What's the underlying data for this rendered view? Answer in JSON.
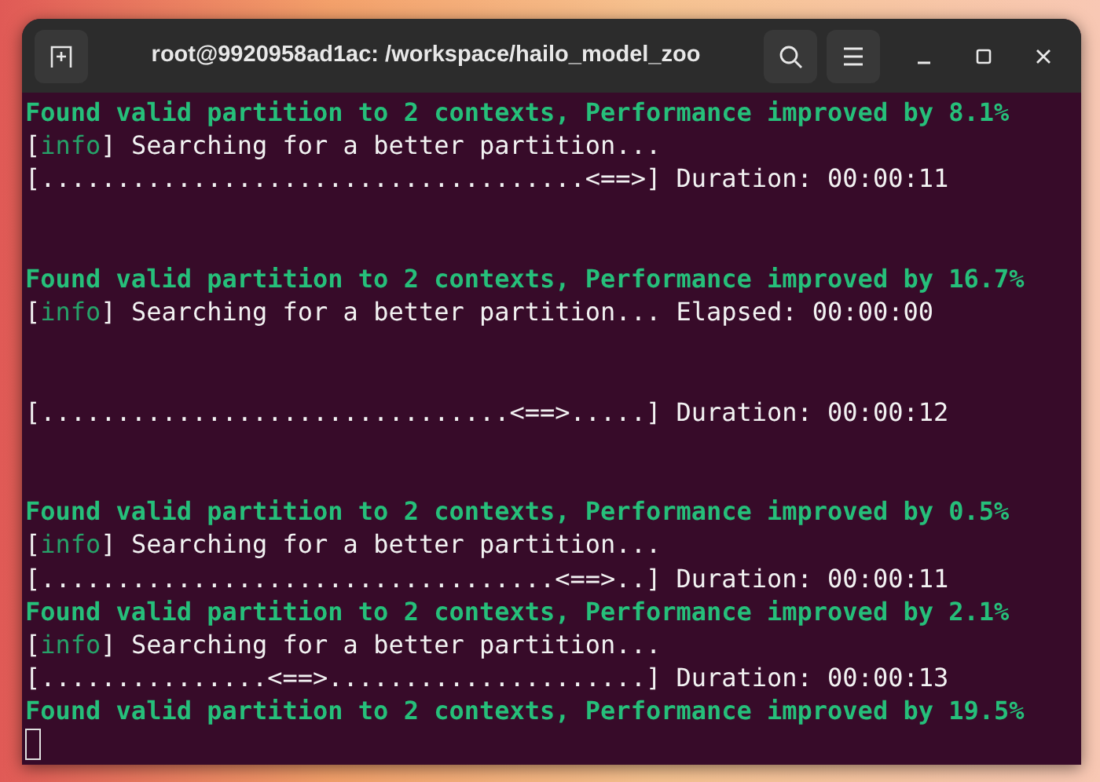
{
  "window": {
    "title": "root@9920958ad1ac: /workspace/hailo_model_zoo"
  },
  "lines": [
    {
      "kind": "found",
      "text": "Found valid partition to 2 contexts, Performance improved by 8.1%"
    },
    {
      "kind": "info",
      "open": "[",
      "tag": "info",
      "text": "] Searching for a better partition..."
    },
    {
      "kind": "plain",
      "text": "[....................................<==>] Duration: 00:00:11"
    },
    {
      "kind": "blank"
    },
    {
      "kind": "blank"
    },
    {
      "kind": "found",
      "text": "Found valid partition to 2 contexts, Performance improved by 16.7%"
    },
    {
      "kind": "info",
      "open": "[",
      "tag": "info",
      "text": "] Searching for a better partition... Elapsed: 00:00:00"
    },
    {
      "kind": "blank"
    },
    {
      "kind": "blank"
    },
    {
      "kind": "plain",
      "text": "[...............................<==>.....] Duration: 00:00:12"
    },
    {
      "kind": "blank"
    },
    {
      "kind": "blank"
    },
    {
      "kind": "found",
      "text": "Found valid partition to 2 contexts, Performance improved by 0.5%"
    },
    {
      "kind": "info",
      "open": "[",
      "tag": "info",
      "text": "] Searching for a better partition..."
    },
    {
      "kind": "plain",
      "text": "[..................................<==>..] Duration: 00:00:11"
    },
    {
      "kind": "found",
      "text": "Found valid partition to 2 contexts, Performance improved by 2.1%"
    },
    {
      "kind": "info",
      "open": "[",
      "tag": "info",
      "text": "] Searching for a better partition..."
    },
    {
      "kind": "plain",
      "text": "[...............<==>.....................] Duration: 00:00:13"
    },
    {
      "kind": "found",
      "text": "Found valid partition to 2 contexts, Performance improved by 19.5%"
    },
    {
      "kind": "cursor"
    }
  ]
}
